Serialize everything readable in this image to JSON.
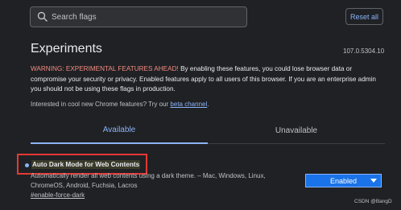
{
  "search": {
    "placeholder": "Search flags"
  },
  "header": {
    "reset_label": "Reset all"
  },
  "page": {
    "title": "Experiments",
    "version": "107.0.5304.10",
    "warning_head": "WARNING: EXPERIMENTAL FEATURES AHEAD!",
    "warning_body": " By enabling these features, you could lose browser data or compromise your security or privacy. Enabled features apply to all users of this browser. If you are an enterprise admin you should not be using these flags in production.",
    "interested_text": "Interested in cool new Chrome features? Try our ",
    "interested_link": "beta channel",
    "interested_suffix": "."
  },
  "tabs": [
    {
      "label": "Available"
    },
    {
      "label": "Unavailable"
    }
  ],
  "flag": {
    "title": "Auto Dark Mode for Web Contents",
    "description": "Automatically render all web contents using a dark theme. – Mac, Windows, Linux, ChromeOS, Android, Fuchsia, Lacros",
    "anchor": "#enable-force-dark",
    "selected_option": "Enabled"
  },
  "watermark": "CSDN @BangD",
  "colors": {
    "background": "#202124",
    "accent": "#8ab4f8",
    "warning": "#f28b82",
    "select_bg": "#1a73e8",
    "highlight": "#e53935"
  }
}
